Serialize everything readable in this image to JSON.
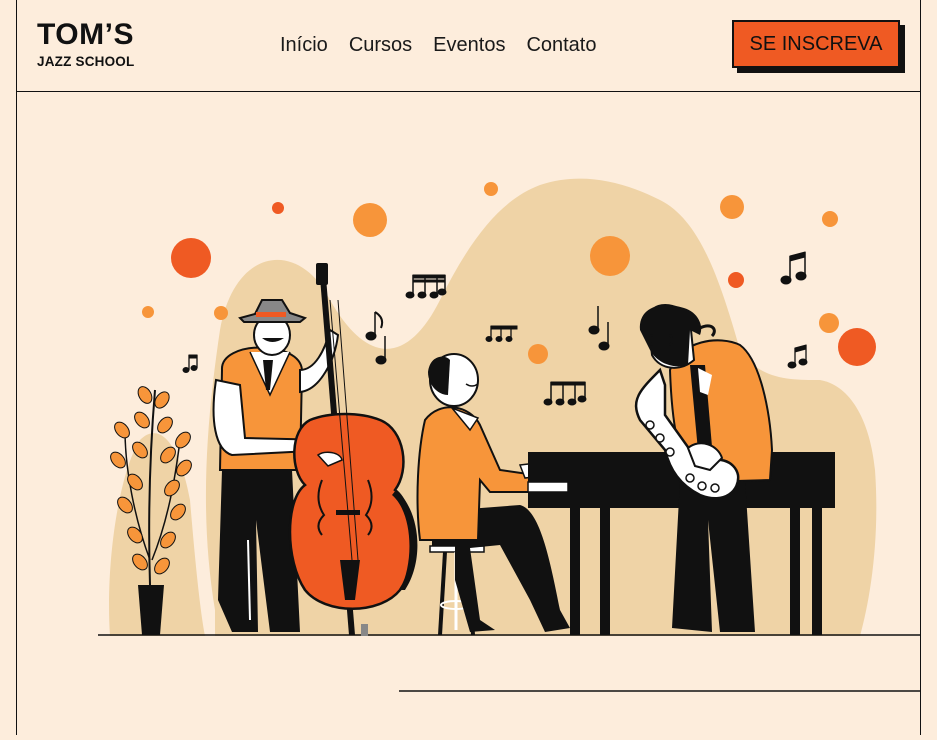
{
  "brand": {
    "title": "TOM’S",
    "subtitle": "JAZZ SCHOOL"
  },
  "nav": [
    "Início",
    "Cursos",
    "Eventos",
    "Contato"
  ],
  "cta": {
    "label": "SE INSCREVA"
  },
  "colors": {
    "background": "#fdeddc",
    "accent": "#ef5a23",
    "orange": "#f7953a",
    "sand": "#efd3a6",
    "ink": "#111111"
  },
  "hero": {
    "illustration": "jazz-band-illustration"
  }
}
